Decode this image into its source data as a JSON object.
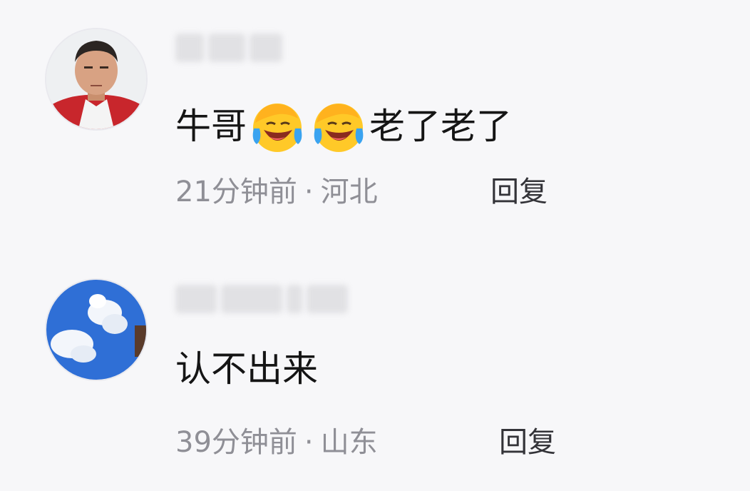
{
  "comments": [
    {
      "avatar": "avatar-photo-man",
      "text_prefix": "牛哥",
      "emojis": [
        "facepalm-laugh-cry-icon",
        "facepalm-laugh-cry-icon"
      ],
      "text_suffix": "老了老了",
      "time": "21分钟前",
      "separator": "·",
      "location": "河北",
      "reply_label": "回复"
    },
    {
      "avatar": "avatar-sky-clouds",
      "text": "认不出来",
      "time": "39分钟前",
      "separator": "·",
      "location": "山东",
      "reply_label": "回复"
    }
  ],
  "colors": {
    "background": "#f7f7f9",
    "text": "#151515",
    "meta": "#8f8f96",
    "reply": "#333338",
    "emoji_yellow": "#ffc928",
    "emoji_tear": "#3aa3f0"
  }
}
